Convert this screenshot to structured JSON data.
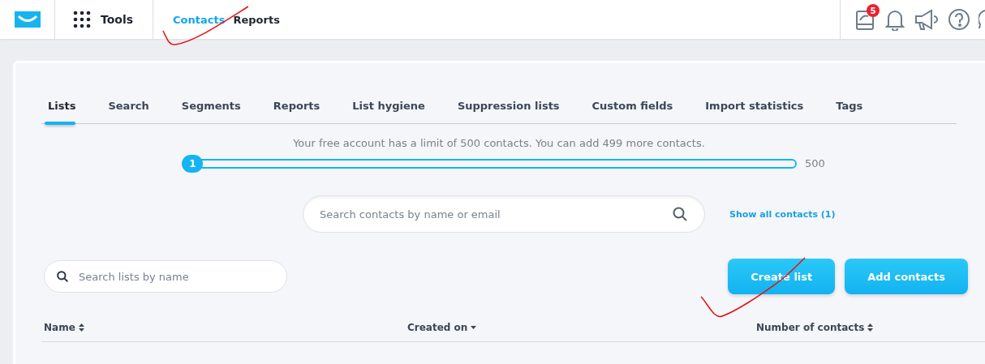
{
  "top_nav": {
    "tools_label": "Tools",
    "items": [
      {
        "label": "Contacts",
        "selected": true
      },
      {
        "label": "Reports",
        "selected": false
      }
    ],
    "notification_badge": "5"
  },
  "tabs": [
    {
      "label": "Lists",
      "selected": true
    },
    {
      "label": "Search",
      "selected": false
    },
    {
      "label": "Segments",
      "selected": false
    },
    {
      "label": "Reports",
      "selected": false
    },
    {
      "label": "List hygiene",
      "selected": false
    },
    {
      "label": "Suppression lists",
      "selected": false
    },
    {
      "label": "Custom fields",
      "selected": false
    },
    {
      "label": "Import statistics",
      "selected": false
    },
    {
      "label": "Tags",
      "selected": false
    }
  ],
  "limit": {
    "message": "Your free account has a limit of 500 contacts. You can add 499 more contacts.",
    "current": "1",
    "max": "500",
    "level": 0.002
  },
  "contact_search": {
    "placeholder": "Search contacts by name or email",
    "show_all_link": "Show all contacts (1)"
  },
  "list_search": {
    "placeholder": "Search lists by name"
  },
  "buttons": [
    "Create list",
    "Add contacts"
  ],
  "table": {
    "columns": [
      {
        "label": "Name",
        "kind": "sortable"
      },
      {
        "label": "Created on",
        "kind": "sorted"
      },
      {
        "label": "Number of contacts",
        "kind": "sortable"
      }
    ]
  }
}
